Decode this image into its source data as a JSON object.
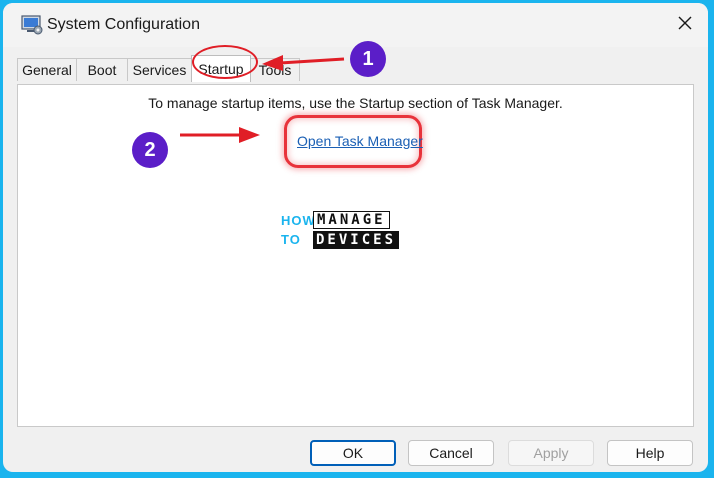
{
  "window": {
    "title": "System Configuration"
  },
  "tabs": [
    {
      "label": "General"
    },
    {
      "label": "Boot"
    },
    {
      "label": "Services"
    },
    {
      "label": "Startup",
      "active": true
    },
    {
      "label": "Tools"
    }
  ],
  "startup": {
    "instruction": "To manage startup items, use the Startup section of Task Manager.",
    "link_label": "Open Task Manager"
  },
  "logo": {
    "how": "HOW",
    "to": "TO",
    "manage": "MANAGE",
    "devices": "DEVICES"
  },
  "buttons": {
    "ok": "OK",
    "cancel": "Cancel",
    "apply": "Apply",
    "help": "Help"
  },
  "annotations": {
    "step1": "1",
    "step2": "2",
    "circle_color": "#5b1ec8",
    "arrow_color": "#e01e26"
  },
  "colors": {
    "background": "#1ab4ee",
    "link": "#1a5fb4",
    "highlight": "#e8333b"
  }
}
